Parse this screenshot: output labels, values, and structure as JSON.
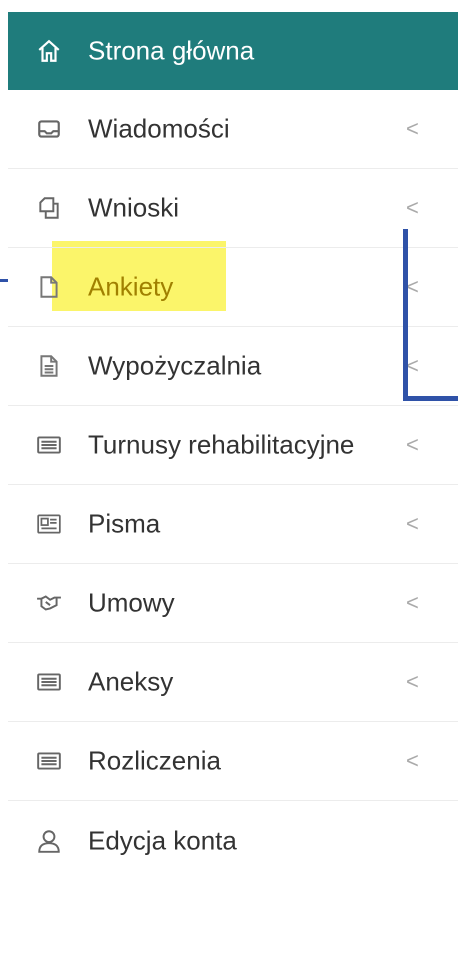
{
  "menu": {
    "items": [
      {
        "label": "Strona główna",
        "icon": "home-icon",
        "chevron": ""
      },
      {
        "label": "Wiadomości",
        "icon": "inbox-icon",
        "chevron": "<"
      },
      {
        "label": "Wnioski",
        "icon": "copy-icon",
        "chevron": "<"
      },
      {
        "label": "Ankiety",
        "icon": "file-icon",
        "chevron": "<"
      },
      {
        "label": "Wypożyczalnia",
        "icon": "file-text-icon",
        "chevron": "<"
      },
      {
        "label": "Turnusy rehabilitacyjne",
        "icon": "list-card-icon",
        "chevron": "<"
      },
      {
        "label": "Pisma",
        "icon": "newspaper-icon",
        "chevron": "<"
      },
      {
        "label": "Umowy",
        "icon": "handshake-icon",
        "chevron": "<"
      },
      {
        "label": "Aneksy",
        "icon": "list-card-icon",
        "chevron": "<"
      },
      {
        "label": "Rozliczenia",
        "icon": "list-card-icon",
        "chevron": "<"
      },
      {
        "label": "Edycja konta",
        "icon": "user-icon",
        "chevron": ""
      }
    ]
  },
  "colors": {
    "active_bg": "#1f7c7c",
    "highlight": "#fbf56a",
    "annotation": "#2f52a8"
  }
}
